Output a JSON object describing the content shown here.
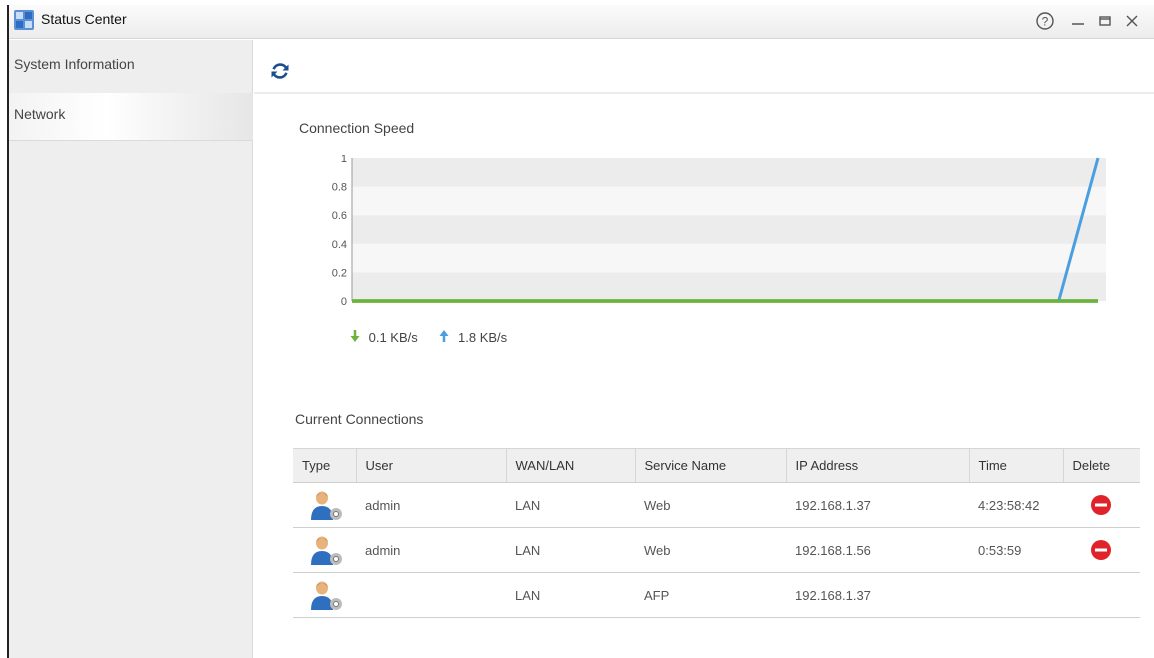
{
  "window": {
    "title": "Status Center",
    "icons": [
      "app-icon",
      "help-icon",
      "minimize-icon",
      "maximize-icon",
      "close-icon"
    ]
  },
  "sidebar": {
    "items": [
      {
        "label": "System Information",
        "active": false
      },
      {
        "label": "Network",
        "active": true
      }
    ]
  },
  "main": {
    "refresh_icon": "refresh-icon",
    "connection_speed": {
      "title": "Connection Speed",
      "download_label": "0.1 KB/s",
      "upload_label": "1.8 KB/s"
    },
    "current_connections": {
      "title": "Current Connections",
      "columns": [
        "Type",
        "User",
        "WAN/LAN",
        "Service Name",
        "IP Address",
        "Time",
        "Delete"
      ],
      "rows": [
        {
          "user": "admin",
          "wan_lan": "LAN",
          "service": "Web",
          "ip": "192.168.1.37",
          "time": "4:23:58:42",
          "deletable": true
        },
        {
          "user": "admin",
          "wan_lan": "LAN",
          "service": "Web",
          "ip": "192.168.1.56",
          "time": "0:53:59",
          "deletable": true
        },
        {
          "user": "",
          "wan_lan": "LAN",
          "service": "AFP",
          "ip": "192.168.1.37",
          "time": "",
          "deletable": false
        }
      ]
    }
  },
  "colors": {
    "download": "#6cb33e",
    "upload": "#4a9fe0",
    "refresh": "#1b4e8f",
    "delete": "#e0232b"
  },
  "chart_data": {
    "type": "line",
    "title": "",
    "xlabel": "",
    "ylabel": "",
    "ylim": [
      0,
      1
    ],
    "yticks": [
      "0",
      "0.2",
      "0.4",
      "0.6",
      "0.8",
      "1"
    ],
    "grid": true,
    "series": [
      {
        "values": [
          0,
          0,
          0,
          0,
          0,
          0,
          0,
          0,
          0,
          0,
          0,
          0,
          0,
          0,
          0,
          0,
          0,
          0,
          0,
          0
        ]
      },
      {
        "values": [
          0,
          0,
          0,
          0,
          0,
          0,
          0,
          0,
          0,
          0,
          0,
          0,
          0,
          0,
          0,
          0,
          0,
          0,
          0,
          1
        ]
      }
    ]
  }
}
